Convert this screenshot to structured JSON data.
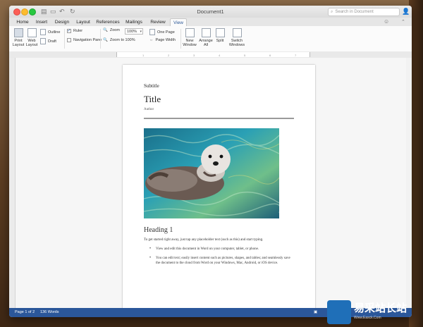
{
  "app": {
    "document_title": "Document1",
    "search_placeholder": "Search in Document"
  },
  "tabs": [
    "Home",
    "Insert",
    "Design",
    "Layout",
    "References",
    "Mailings",
    "Review",
    "View"
  ],
  "active_tab": "View",
  "ribbon": {
    "print_layout": [
      "Print",
      "Layout"
    ],
    "web_layout": [
      "Web",
      "Layout"
    ],
    "outline": "Outline",
    "draft": "Draft",
    "ruler": "Ruler",
    "ruler_checked": true,
    "navigation_pane": "Navigation Pane",
    "zoom": "Zoom",
    "zoom_value": "100%",
    "zoom_100": "Zoom to 100%",
    "one_page": "One Page",
    "page_width": "Page Width",
    "new_window": [
      "New",
      "Window"
    ],
    "arrange_all": [
      "Arrange",
      "All"
    ],
    "split": "Split",
    "switch_windows": [
      "Switch",
      "Windows"
    ]
  },
  "ruler_ticks": [
    "1",
    "2",
    "3",
    "4",
    "5",
    "6",
    "7"
  ],
  "document": {
    "subtitle": "Subtitle",
    "title": "Title",
    "author": "Author",
    "heading1": "Heading 1",
    "body": "To get started right away, just tap any placeholder text (such as this) and start typing.",
    "bullets": [
      "View and edit this document in Word on your computer, tablet, or phone.",
      "You can edit text; easily insert content such as pictures, shapes, and tables; and seamlessly save the document to the cloud from Word on your Windows, Mac, Android, or iOS device."
    ]
  },
  "status": {
    "page": "Page 1 of 2",
    "words": "136 Words"
  },
  "watermark": {
    "brand": "易采站长站",
    "url": "Www.Easck.Com"
  },
  "colors": {
    "accent": "#2b579a",
    "close": "#fc5f57",
    "minimize": "#fdbc2e",
    "zoom": "#28c840"
  }
}
